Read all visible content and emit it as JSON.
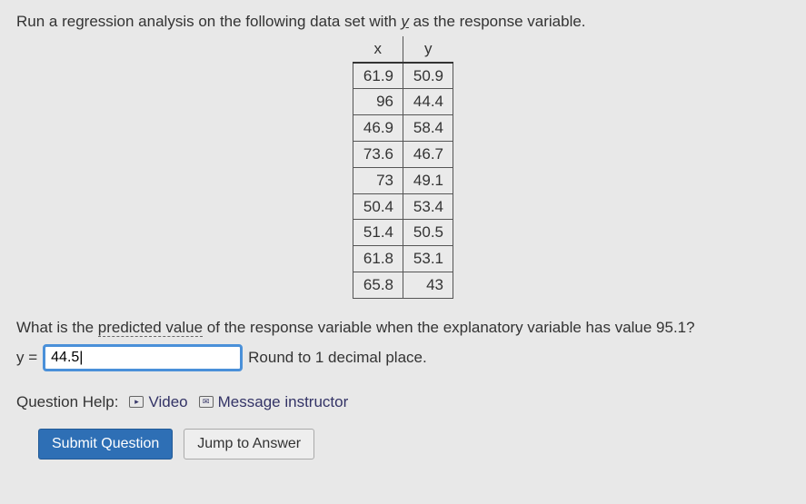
{
  "prompt": {
    "lead": "Run a regression analysis on the following data set with ",
    "yvar": "y",
    "tail": " as the response variable."
  },
  "table": {
    "headers": {
      "x": "x",
      "y": "y"
    },
    "rows": [
      {
        "x": "61.9",
        "y": "50.9"
      },
      {
        "x": "96",
        "y": "44.4"
      },
      {
        "x": "46.9",
        "y": "58.4"
      },
      {
        "x": "73.6",
        "y": "46.7"
      },
      {
        "x": "73",
        "y": "49.1"
      },
      {
        "x": "50.4",
        "y": "53.4"
      },
      {
        "x": "51.4",
        "y": "50.5"
      },
      {
        "x": "61.8",
        "y": "53.1"
      },
      {
        "x": "65.8",
        "y": "43"
      }
    ]
  },
  "question": {
    "lead": "What is the ",
    "underlined": "predicted value",
    "tail": " of the response variable when the explanatory variable has value 95.1?"
  },
  "answer": {
    "prefix": "y = ",
    "value": "44.5|",
    "suffix": "Round to 1 decimal place."
  },
  "help": {
    "label": "Question Help:",
    "video": "Video",
    "message": "Message instructor"
  },
  "buttons": {
    "submit": "Submit Question",
    "jump": "Jump to Answer"
  },
  "icons": {
    "play": "▸",
    "mail": "✉"
  }
}
